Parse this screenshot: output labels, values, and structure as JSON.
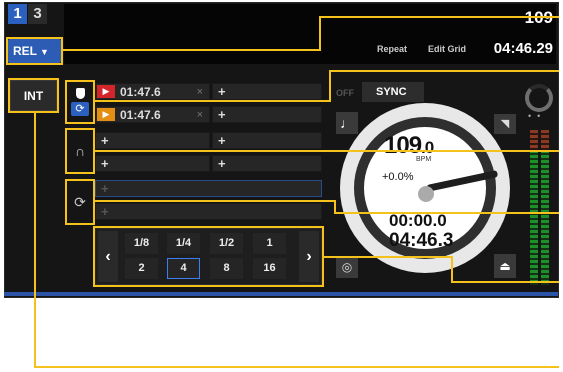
{
  "deck": {
    "numbers": [
      "1",
      "3"
    ],
    "mode_button": "REL",
    "int_button": "INT",
    "bpm_display": "109",
    "repeat_label": "Repeat",
    "edit_grid_label": "Edit Grid",
    "track_time": "04:46.29"
  },
  "cue_points": [
    {
      "time": "01:47.6",
      "color": "#d3262a",
      "remove": "×"
    },
    {
      "time": "01:47.6",
      "color": "#e38f12",
      "remove": "×"
    }
  ],
  "add_symbol": "+",
  "loop_panel": {
    "prev": "‹",
    "next": "›",
    "row1": [
      "1/8",
      "1/4",
      "1/2",
      "1"
    ],
    "row2": [
      "2",
      "4",
      "8",
      "16"
    ],
    "selected": "4"
  },
  "sync": {
    "off_label": "OFF",
    "label": "SYNC"
  },
  "platter": {
    "bpm_whole": "109",
    "bpm_decimal": ".0",
    "bpm_unit": "BPM",
    "pitch": "+0.0%",
    "elapsed": "00:00.0",
    "remaining": "04:46.3"
  },
  "icons": {
    "note": "♩",
    "triangle": "◥",
    "gauge": "◎",
    "eject": "⏏",
    "headphone": "∩",
    "loop": "⟳",
    "play": "▶"
  },
  "colors": {
    "highlight": "#f5c21b",
    "deck_blue": "#2b5fc0",
    "cue_red": "#d3262a",
    "cue_orange": "#e38f12"
  }
}
